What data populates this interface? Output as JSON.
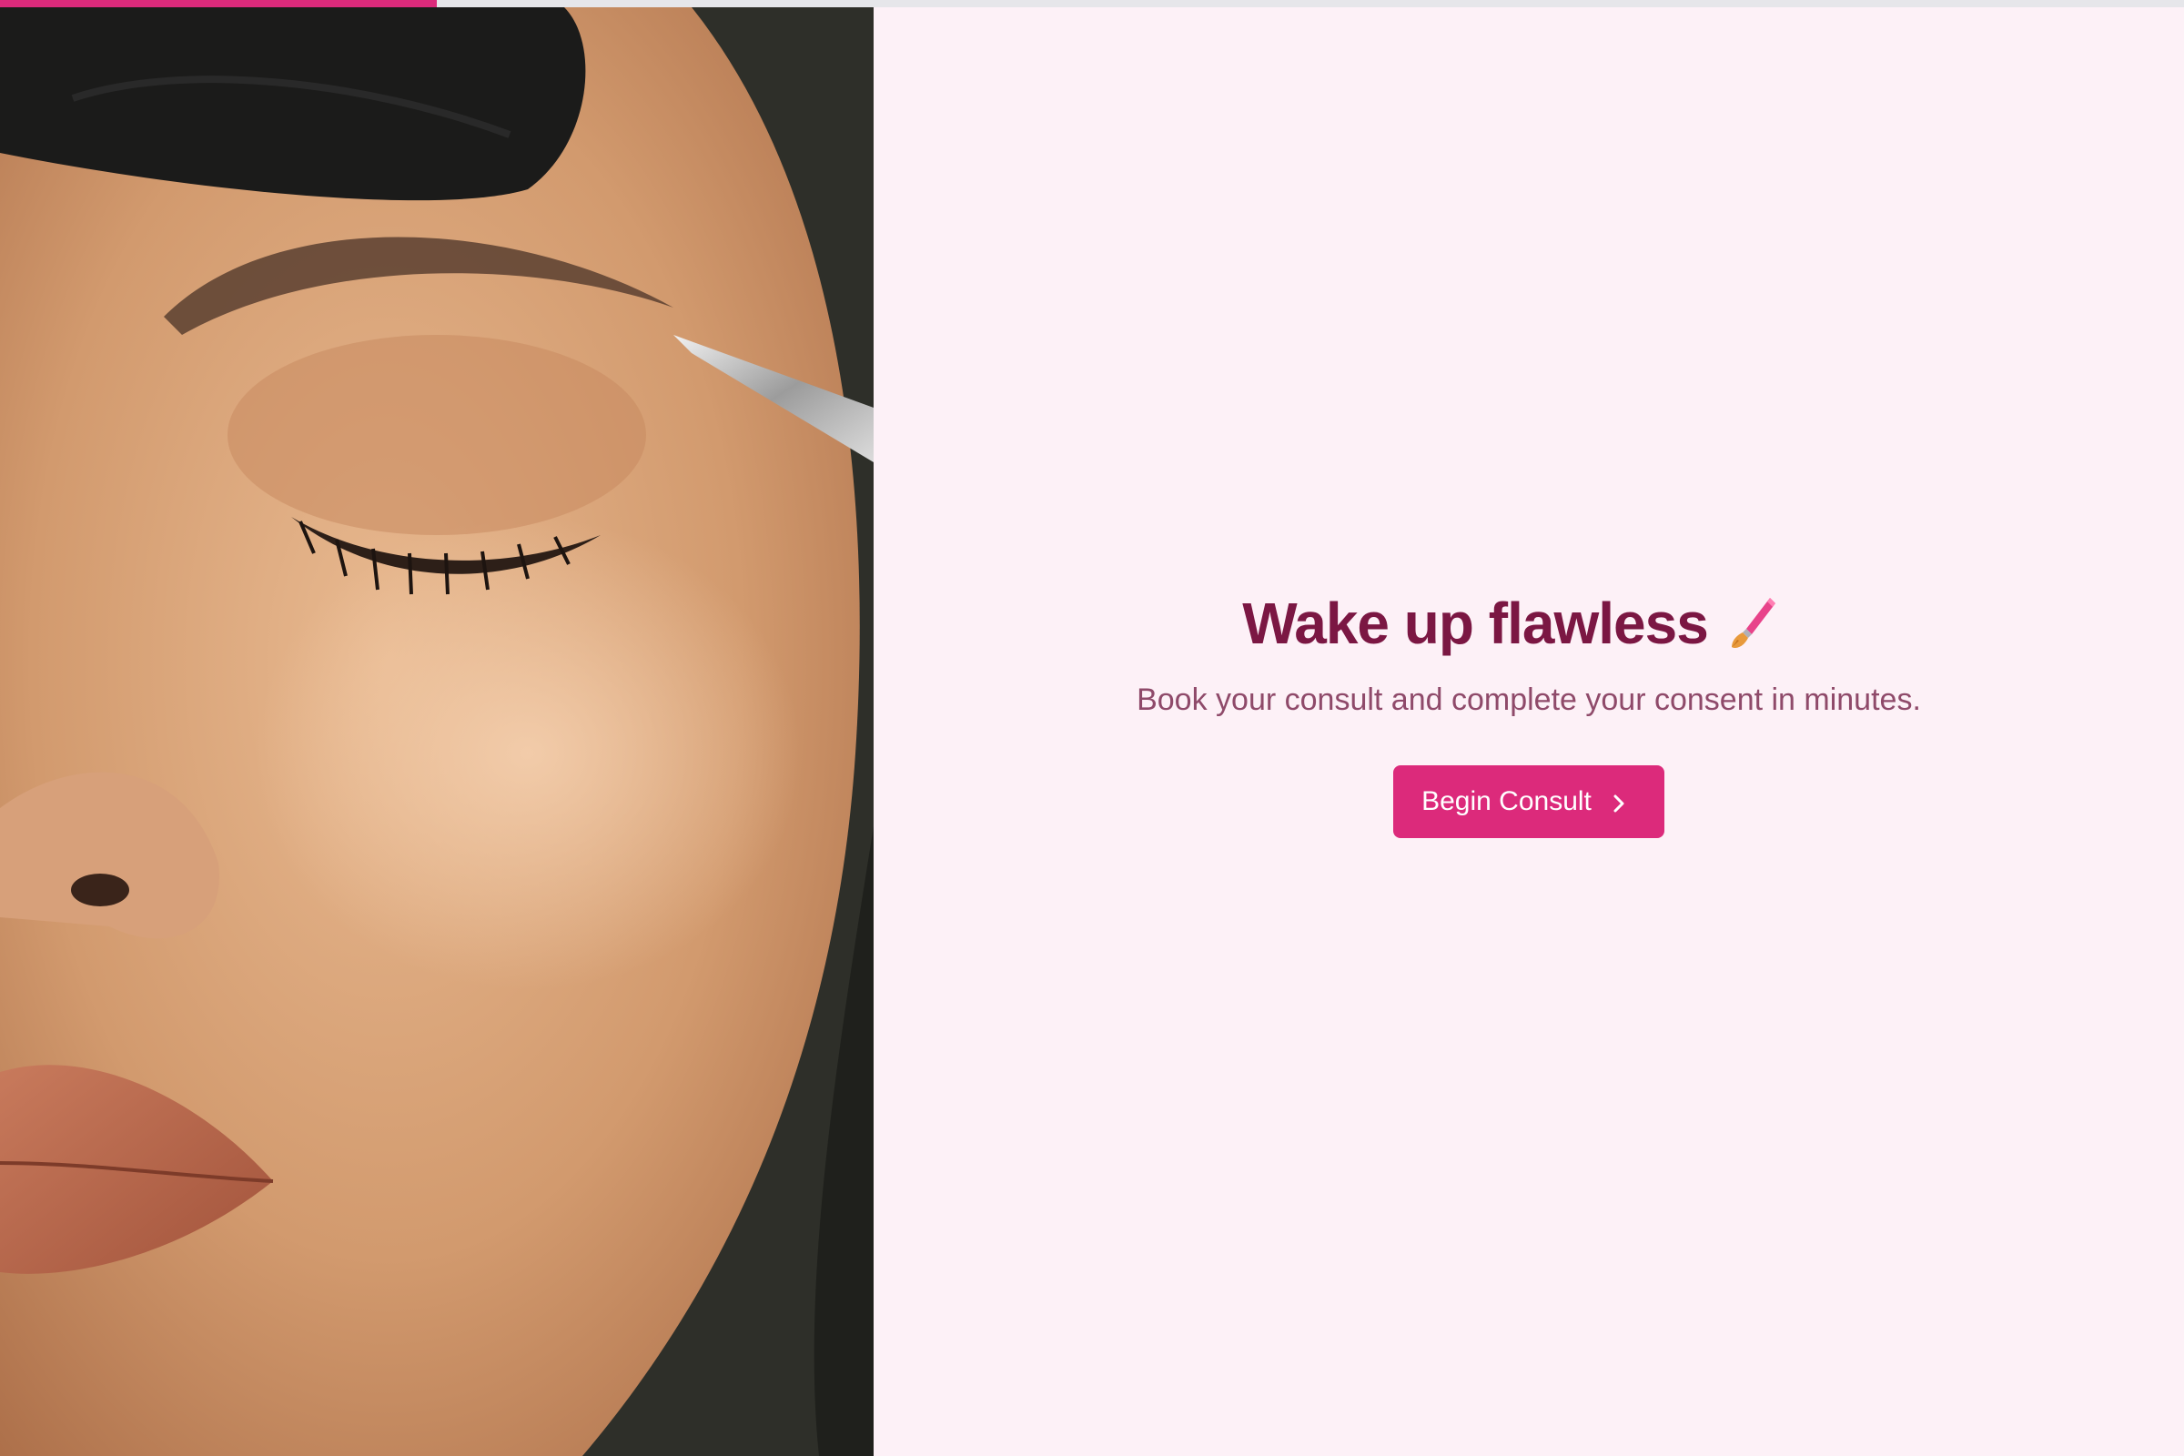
{
  "progress": {
    "value": 0.2
  },
  "hero": {
    "headline": "Wake up flawless",
    "headline_icon": "makeup-brush-icon",
    "subtitle": "Book your consult and complete your consent in minutes.",
    "cta_label": "Begin Consult",
    "cta_icon": "chevron-right-icon"
  },
  "colors": {
    "accent": "#dc2a7b",
    "heading": "#7b1743",
    "subtitle": "#8f4a6a",
    "background": "#fdf1f7",
    "progress_track": "#e6e6ea"
  }
}
